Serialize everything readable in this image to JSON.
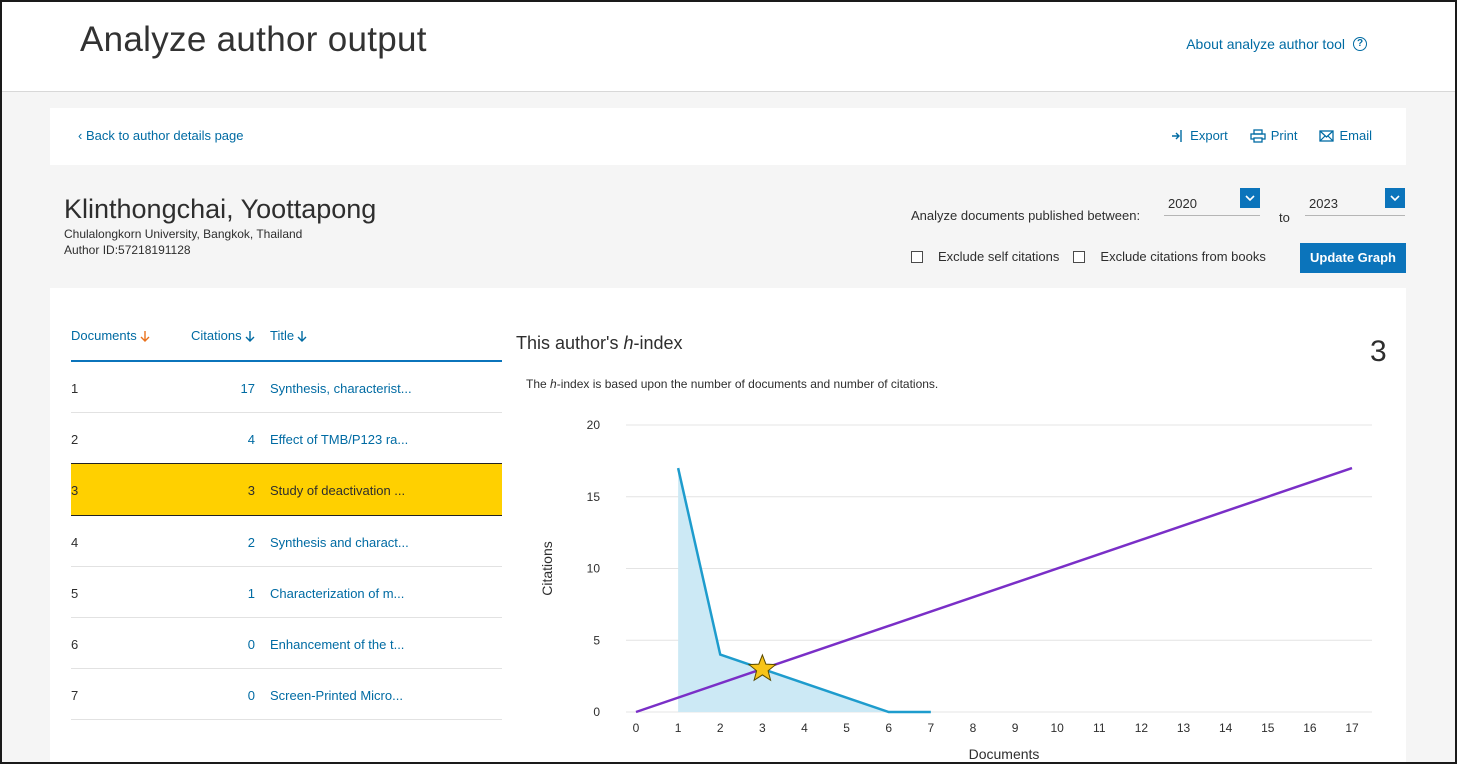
{
  "header": {
    "title": "Analyze author output",
    "about_link": "About analyze author tool"
  },
  "actionbar": {
    "back_link": "Back to author details page",
    "export_label": "Export",
    "print_label": "Print",
    "email_label": "Email"
  },
  "author": {
    "name": "Klinthongchai, Yoottapong",
    "affiliation": "Chulalongkorn University, Bangkok, Thailand",
    "author_id": "Author ID:57218191128"
  },
  "filters": {
    "range_label": "Analyze documents published between:",
    "from_year": "2020",
    "to_label": "to",
    "to_year": "2023",
    "exclude_self_label": "Exclude self citations",
    "exclude_books_label": "Exclude citations from books",
    "update_button": "Update Graph"
  },
  "table": {
    "headers": {
      "documents": "Documents",
      "citations": "Citations",
      "title": "Title"
    },
    "rows": [
      {
        "doc": "1",
        "citations": "17",
        "title": "Synthesis, characterist..."
      },
      {
        "doc": "2",
        "citations": "4",
        "title": "Effect of TMB/P123 ra..."
      },
      {
        "doc": "3",
        "citations": "3",
        "title": "Study of deactivation ..."
      },
      {
        "doc": "4",
        "citations": "2",
        "title": "Synthesis and charact..."
      },
      {
        "doc": "5",
        "citations": "1",
        "title": "Characterization of m..."
      },
      {
        "doc": "6",
        "citations": "0",
        "title": "Enhancement of the t..."
      },
      {
        "doc": "7",
        "citations": "0",
        "title": "Screen-Printed Micro..."
      }
    ],
    "highlighted_row": 3
  },
  "hindex": {
    "title_prefix": "This author's ",
    "title_h": "h",
    "title_suffix": "-index",
    "value": "3",
    "desc_prefix": "The ",
    "desc_h": "h",
    "desc_suffix": "-index is based upon the number of documents and number of citations."
  },
  "colors": {
    "accent": "#0b74bb",
    "link": "#006ba3",
    "highlight": "#ffd000",
    "area_fill": "#cce9f5",
    "area_line": "#1e9ccd",
    "diagonal": "#7a2fc7",
    "star": "#f7c418"
  },
  "chart_data": {
    "type": "area",
    "xlabel": "Documents",
    "ylabel": "Citations",
    "xlim": [
      0,
      17
    ],
    "ylim": [
      0,
      20
    ],
    "x_ticks": [
      "0",
      "1",
      "2",
      "3",
      "4",
      "5",
      "6",
      "7",
      "8",
      "9",
      "10",
      "11",
      "12",
      "13",
      "14",
      "15",
      "16",
      "17"
    ],
    "y_ticks": [
      "0",
      "5",
      "10",
      "15",
      "20"
    ],
    "grid": true,
    "series": [
      {
        "type": "area",
        "x": [
          1,
          2,
          3,
          4,
          5,
          6,
          7
        ],
        "values": [
          17,
          4,
          3,
          2,
          1,
          0,
          0
        ]
      },
      {
        "type": "line",
        "x": [
          0,
          17
        ],
        "values": [
          0,
          17
        ]
      }
    ],
    "marker": {
      "shape": "star",
      "x": 3,
      "y": 3
    }
  }
}
